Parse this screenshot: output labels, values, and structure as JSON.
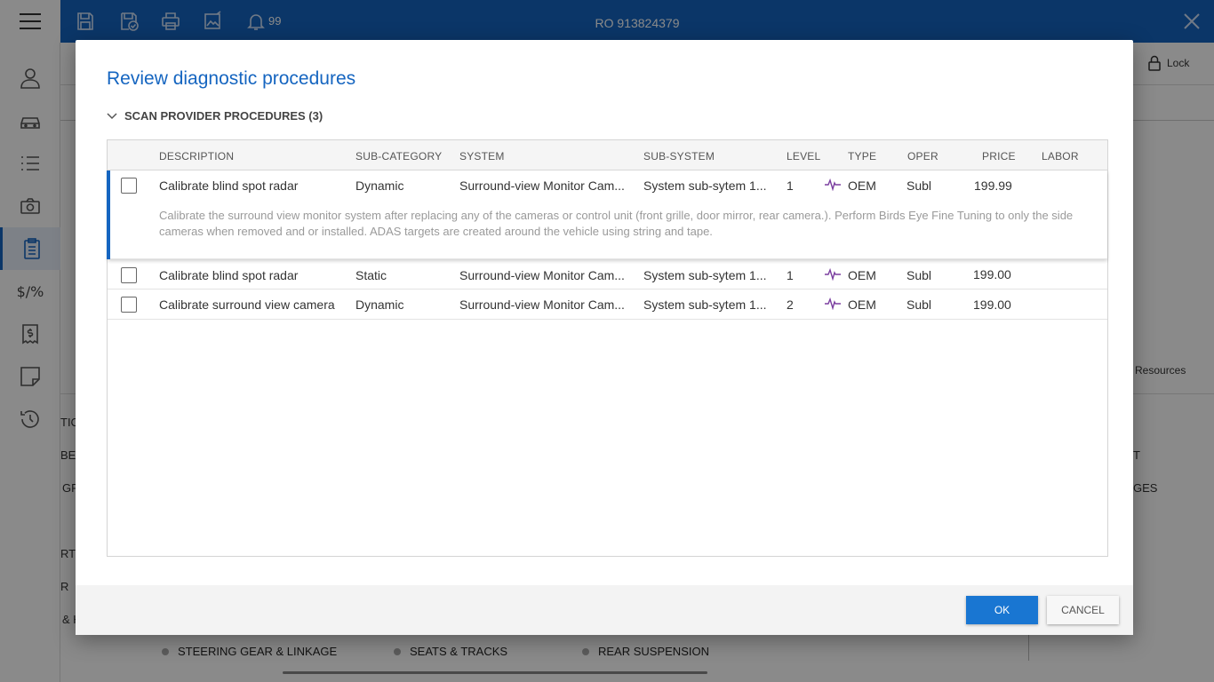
{
  "app": {
    "title": "RO 913824379",
    "notification_count": "99",
    "lock_label": "Lock",
    "resources_label": "Resources",
    "sidebar_tax_label": "$/%",
    "bg_fragments": [
      "TIC",
      "BEL",
      "GR",
      "RT",
      "R",
      "& H",
      "T",
      "GES"
    ],
    "bg_categories": [
      "STEERING GEAR & LINKAGE",
      "SEATS & TRACKS",
      "REAR SUSPENSION"
    ]
  },
  "modal": {
    "title": "Review diagnostic procedures",
    "section_label": "SCAN PROVIDER PROCEDURES (3)",
    "columns": [
      "DESCRIPTION",
      "SUB-CATEGORY",
      "SYSTEM",
      "SUB-SYSTEM",
      "LEVEL",
      "TYPE",
      "OPER",
      "PRICE",
      "LABOR"
    ],
    "rows": [
      {
        "description": "Calibrate blind spot radar",
        "sub_category": "Dynamic",
        "system": "Surround-view Monitor Cam...",
        "sub_system": "System sub-sytem 1...",
        "level": "1",
        "type": "OEM",
        "oper": "Subl",
        "price": "199.99",
        "labor": "",
        "checked": false,
        "details": "Calibrate the surround view monitor system after replacing any of the cameras or control unit (front grille, door mirror, rear camera.). Perform Birds Eye Fine Tuning to only the side cameras when removed and or installed. ADAS targets are created around the vehicle using string and tape."
      },
      {
        "description": "Calibrate blind spot radar",
        "sub_category": "Static",
        "system": "Surround-view Monitor Cam...",
        "sub_system": "System sub-sytem 1...",
        "level": "1",
        "type": "OEM",
        "oper": "Subl",
        "price": "199.00",
        "labor": "",
        "checked": false
      },
      {
        "description": "Calibrate surround view camera",
        "sub_category": "Dynamic",
        "system": "Surround-view Monitor Cam...",
        "sub_system": "System sub-sytem 1...",
        "level": "2",
        "type": "OEM",
        "oper": "Subl",
        "price": "199.00",
        "labor": "",
        "checked": false
      }
    ],
    "ok_label": "OK",
    "cancel_label": "CANCEL"
  },
  "colors": {
    "brand": "#1565c0",
    "primary_button": "#1976d2",
    "type_icon": "#7b3fa0",
    "overlay": "rgba(0,0,0,0.46)"
  },
  "icons": {
    "toolbar": [
      "save-icon",
      "save-check-icon",
      "print-icon",
      "image-export-icon",
      "bell-icon"
    ],
    "sidebar": [
      "person-icon",
      "car-icon",
      "list-icon",
      "camera-icon",
      "clipboard-icon",
      "tax-percent-icon",
      "invoice-dollar-icon",
      "note-icon",
      "history-icon"
    ],
    "type_column": "waveform-icon"
  }
}
